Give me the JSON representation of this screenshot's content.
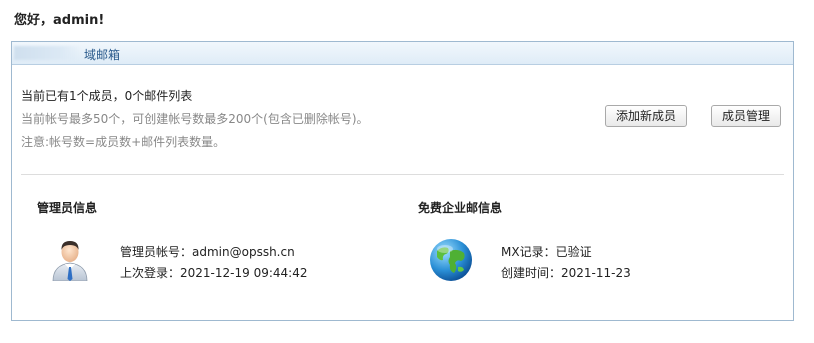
{
  "greeting": "您好，admin!",
  "panel": {
    "title": "域邮箱"
  },
  "stats": {
    "line1": "当前已有1个成员，0个邮件列表",
    "line2": "当前帐号最多50个，可创建帐号数最多200个(包含已删除帐号)。",
    "line3": "注意:帐号数=成员数+邮件列表数量。"
  },
  "buttons": {
    "add": "添加新成员",
    "manage": "成员管理"
  },
  "admin_section": {
    "title": "管理员信息",
    "account_label": "管理员帐号：",
    "account_value": "admin@opssh.cn",
    "last_login_label": "上次登录：",
    "last_login_value": "2021-12-19 09:44:42",
    "icon": "user-icon"
  },
  "free_section": {
    "title": "免费企业邮信息",
    "mx_label": "MX记录：",
    "mx_value": "已验证",
    "created_label": "创建时间：",
    "created_value": "2021-11-23",
    "icon": "globe-icon"
  }
}
